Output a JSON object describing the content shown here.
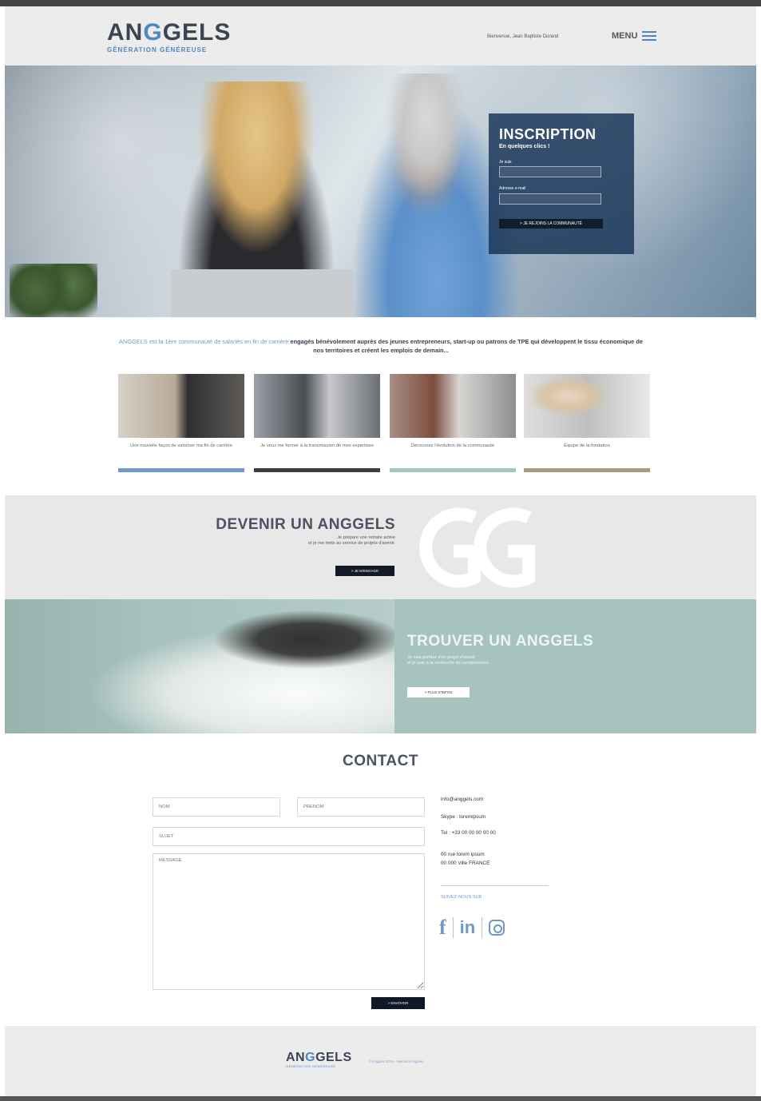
{
  "header": {
    "logo_text_prefix": "AN",
    "logo_text_accent": "G",
    "logo_text_suffix": "GELS",
    "logo_tagline": "GÉNÉRATION GÉNÉREUSE",
    "welcome": "Bienvenue, Jean Baptiste Durand",
    "menu_label": "MENU"
  },
  "hero": {
    "inscription": {
      "title": "INSCRIPTION",
      "subtitle": "En quelques clics !",
      "label_1": "Je suis",
      "label_2": "Adresse e-mail",
      "button": "> JE REJOINS LA COMMUNAUTÉ"
    }
  },
  "intro": {
    "accent_text": "ANGGELS est la 1ère communauté de salariés en fin de carrière",
    "text": " engagés bénévolement auprès des jeunes entrepreneurs, start-up ou patrons de TPE qui développent le tissu économique de nos territoires et créent les emplois de demain..."
  },
  "cards": [
    {
      "caption": "Une nouvelle façon de valoriser ma fin de carrière",
      "color": "#6f9ad0"
    },
    {
      "caption": "Je veux me former à la transmission de mes expertises",
      "color": "#3b3d44"
    },
    {
      "caption": "Découvrez l'évolution de la communauté",
      "color": "#a8c4c0"
    },
    {
      "caption": "Équipe de la fondation",
      "color": "#a79c7f"
    }
  ],
  "devenir": {
    "title": "DEVENIR UN ANGGELS",
    "text_1": "Je prépare une retraite active",
    "text_2": "et je me mets au service de projets d'avenir.",
    "button": "> JE M'ENGAGE"
  },
  "trouver": {
    "title": "TROUVER UN ANGGELS",
    "text_1": "Je suis porteur d'un projet d'avenir",
    "text_2": "et je suis à la recherche de compétences.",
    "button": "> PLUS D'INFOS"
  },
  "contact": {
    "title": "CONTACT",
    "placeholder_nom": "NOM",
    "placeholder_prenom": "PRÉNOM",
    "placeholder_sujet": "SUJET",
    "placeholder_message": "MESSAGE",
    "send_button": "> ENVOYER",
    "email": "info@anggels.com",
    "skype": "Skype : loremipsum",
    "tel": "Tel : +33 00 00 00 00 00",
    "address_1": "00 rue lorem ipsum",
    "address_2": "00 000 Ville FRANCE",
    "follow_label": "SUIVEZ-NOUS SUR",
    "social_fb": "f",
    "social_in": "in"
  },
  "footer": {
    "logo_text_prefix": "AN",
    "logo_text_accent": "G",
    "logo_text_suffix": "GELS",
    "logo_tagline": "GÉNÉRATION GÉNÉREUSE",
    "copyright": "©Anggels 2016 - Mentions légales"
  },
  "colors": {
    "brand_blue": "#4f86c6",
    "dark_navy": "#0f1826",
    "teal": "#a7c3be",
    "light_gray": "#ececec"
  }
}
